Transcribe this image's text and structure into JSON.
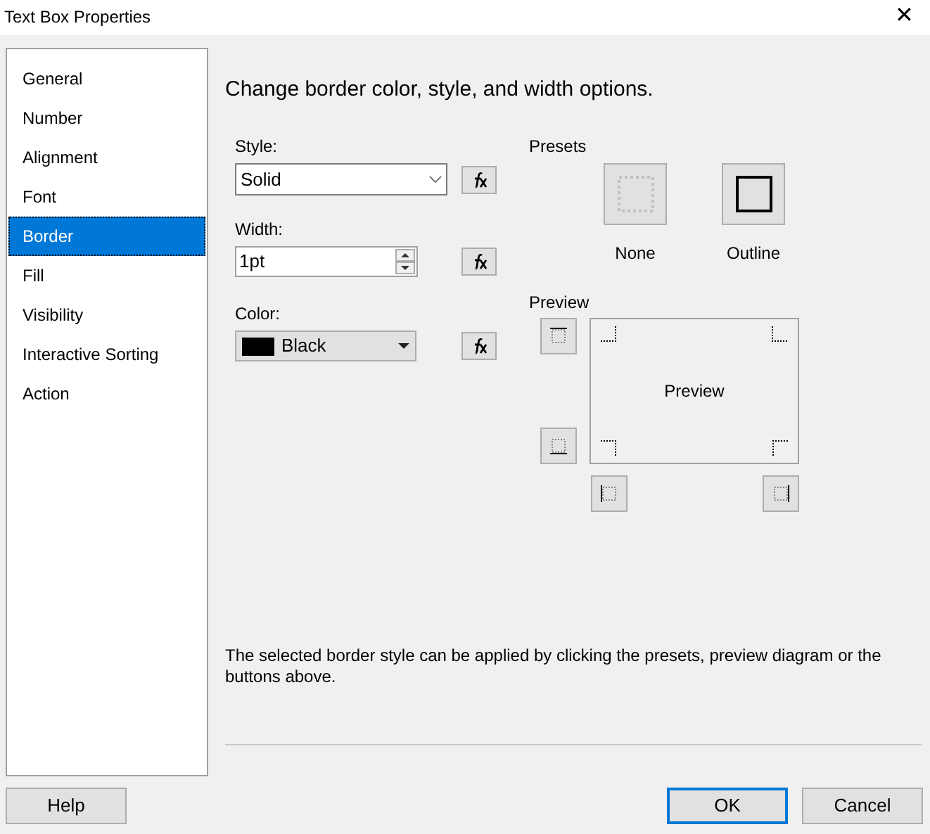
{
  "window": {
    "title": "Text Box Properties",
    "close": "✕"
  },
  "sidebar": {
    "items": [
      {
        "label": "General",
        "selected": false
      },
      {
        "label": "Number",
        "selected": false
      },
      {
        "label": "Alignment",
        "selected": false
      },
      {
        "label": "Font",
        "selected": false
      },
      {
        "label": "Border",
        "selected": true
      },
      {
        "label": "Fill",
        "selected": false
      },
      {
        "label": "Visibility",
        "selected": false
      },
      {
        "label": "Interactive Sorting",
        "selected": false
      },
      {
        "label": "Action",
        "selected": false
      }
    ]
  },
  "heading": "Change border color, style, and width options.",
  "style": {
    "label": "Style:",
    "value": "Solid"
  },
  "width": {
    "label": "Width:",
    "value": "1pt"
  },
  "color": {
    "label": "Color:",
    "value": "Black",
    "color": "#000000"
  },
  "presets": {
    "title": "Presets",
    "items": [
      {
        "label": "None",
        "kind": "none"
      },
      {
        "label": "Outline",
        "kind": "outline"
      }
    ]
  },
  "preview": {
    "title": "Preview",
    "text": "Preview"
  },
  "note": "The selected border style can be applied by clicking the presets, preview diagram or the buttons above.",
  "buttons": [
    {
      "label": "Help",
      "default": false
    },
    {
      "label": "OK",
      "default": true
    },
    {
      "label": "Cancel",
      "default": false
    }
  ]
}
